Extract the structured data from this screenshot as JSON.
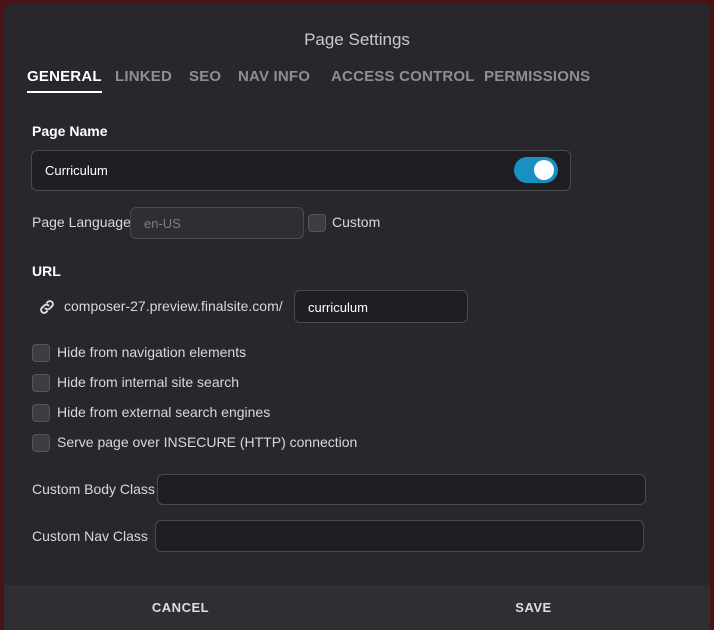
{
  "dialog": {
    "title": "Page Settings",
    "tabs": [
      {
        "label": "GENERAL",
        "active": true
      },
      {
        "label": "LINKED",
        "active": false
      },
      {
        "label": "SEO",
        "active": false
      },
      {
        "label": "NAV INFO",
        "active": false
      },
      {
        "label": "ACCESS CONTROL",
        "active": false
      },
      {
        "label": "PERMISSIONS",
        "active": false
      }
    ]
  },
  "page_name": {
    "label": "Page Name",
    "value": "Curriculum",
    "toggle_on": true
  },
  "language": {
    "label": "Page Language",
    "placeholder": "en-US",
    "custom_label": "Custom",
    "custom_checked": false
  },
  "url": {
    "label": "URL",
    "icon": "link-icon",
    "base": "composer-27.preview.finalsite.com/",
    "slug": "curriculum"
  },
  "options": [
    {
      "label": "Hide from navigation elements",
      "checked": false
    },
    {
      "label": "Hide from internal site search",
      "checked": false
    },
    {
      "label": "Hide from external search engines",
      "checked": false
    },
    {
      "label": "Serve page over INSECURE (HTTP) connection",
      "checked": false
    }
  ],
  "custom_classes": {
    "body_label": "Custom Body Class",
    "body_value": "",
    "nav_label": "Custom Nav Class",
    "nav_value": ""
  },
  "footer": {
    "cancel_label": "CANCEL",
    "save_label": "SAVE"
  },
  "colors": {
    "accent": "#1a8fc2",
    "background": "#28282c",
    "footer": "#2f2f33"
  }
}
